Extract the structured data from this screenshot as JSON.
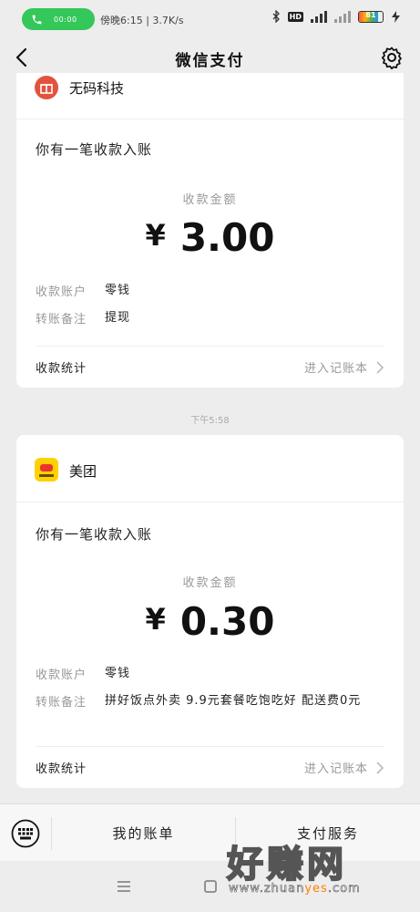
{
  "status_bar": {
    "call_time": "00:00",
    "network_text": "傍晚6:15 | 3.7K/s",
    "battery_level": "81"
  },
  "nav": {
    "title": "微信支付"
  },
  "cards": [
    {
      "brand_name": "无码科技",
      "notice": "你有一笔收款入账",
      "amount_label": "收款金额",
      "currency": "¥",
      "amount": "3.00",
      "rows": [
        {
          "label": "收款账户",
          "value": "零钱"
        },
        {
          "label": "转账备注",
          "value": "提现"
        }
      ],
      "footer_left": "收款统计",
      "footer_right": "进入记账本"
    },
    {
      "brand_name": "美团",
      "notice": "你有一笔收款入账",
      "amount_label": "收款金额",
      "currency": "¥",
      "amount": "0.30",
      "rows": [
        {
          "label": "收款账户",
          "value": "零钱"
        },
        {
          "label": "转账备注",
          "value": "拼好饭点外卖 9.9元套餐吃饱吃好 配送费0元"
        }
      ],
      "footer_left": "收款统计",
      "footer_right": "进入记账本"
    }
  ],
  "timestamp": "下午5:58",
  "bottom_menu": {
    "item1": "我的账单",
    "item2": "支付服务"
  },
  "watermark": {
    "big": "好赚网",
    "url_prefix": "www.zhuan",
    "url_highlight": "yes",
    "url_suffix": ".com"
  },
  "colors": {
    "call_pill": "#34c759",
    "background": "#ededed",
    "card": "#ffffff",
    "muted_text": "#999999"
  }
}
